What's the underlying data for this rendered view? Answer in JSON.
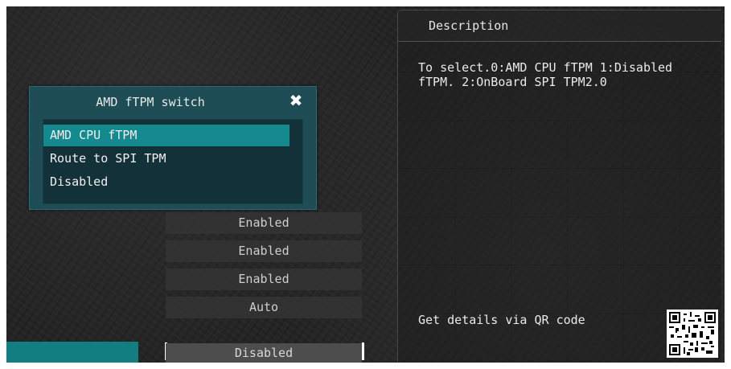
{
  "description_panel": {
    "title": "Description",
    "text": "To select.0:AMD CPU fTPM 1:Disabled\nfTPM. 2:OnBoard SPI TPM2.0",
    "qr_label": "Get details via QR code"
  },
  "values": [
    {
      "label": "Enabled"
    },
    {
      "label": "Enabled"
    },
    {
      "label": "Enabled"
    },
    {
      "label": "Auto"
    }
  ],
  "selected_value": {
    "label": "Disabled"
  },
  "popup": {
    "title": "AMD fTPM switch",
    "close_icon": "close-icon",
    "options": [
      {
        "label": "AMD CPU fTPM",
        "selected": true
      },
      {
        "label": "Route to SPI TPM",
        "selected": false
      },
      {
        "label": "Disabled",
        "selected": false
      }
    ]
  },
  "colors": {
    "accent_teal": "#148a8f",
    "popup_bg": "#1f4d55",
    "background": "#242424"
  }
}
